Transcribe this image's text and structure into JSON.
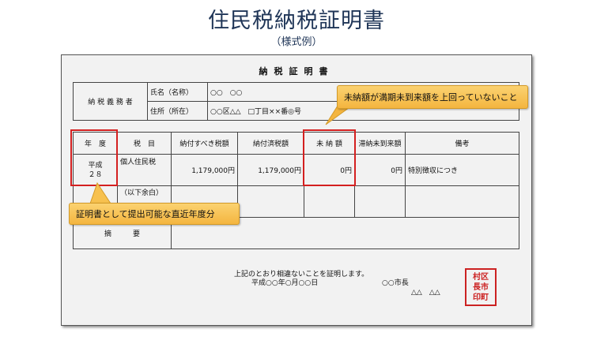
{
  "header": {
    "title": "住民税納税証明書",
    "subtitle": "（様式例）"
  },
  "certificate": {
    "title": "納税証明書",
    "taxpayer": {
      "label": "納 税 義 務 者",
      "name_label": "氏名（名称）",
      "name_value": "○○　○○",
      "address_label": "住所（所在）",
      "address_value": "○○区△△　□丁目××番◎号"
    },
    "table": {
      "headers": [
        "年　度",
        "税　目",
        "納付すべき税額",
        "納付済税額",
        "未 納 額",
        "滞納未到来額",
        "備考"
      ],
      "row": {
        "year": "平成\n２８",
        "tax_item": "個人住民税",
        "amount_due": "1,179,000円",
        "amount_paid": "1,179,000円",
        "unpaid": "0円",
        "not_yet_due": "0円",
        "remarks": "特別徴収につき"
      },
      "blank_row_text": "（以下余白）",
      "summary_label": "摘　　　要"
    },
    "footer": {
      "statement": "上記のとおり相違ないことを証明します。",
      "date": "平成○○年○月○○日",
      "mayor": "○○市長",
      "signature": "△△　△△",
      "stamp": "村区\n長市\n印町"
    }
  },
  "callouts": {
    "unpaid_note": "未納額が満期未到来額を上回っていないこと",
    "year_note": "証明書として提出可能な直近年度分"
  }
}
